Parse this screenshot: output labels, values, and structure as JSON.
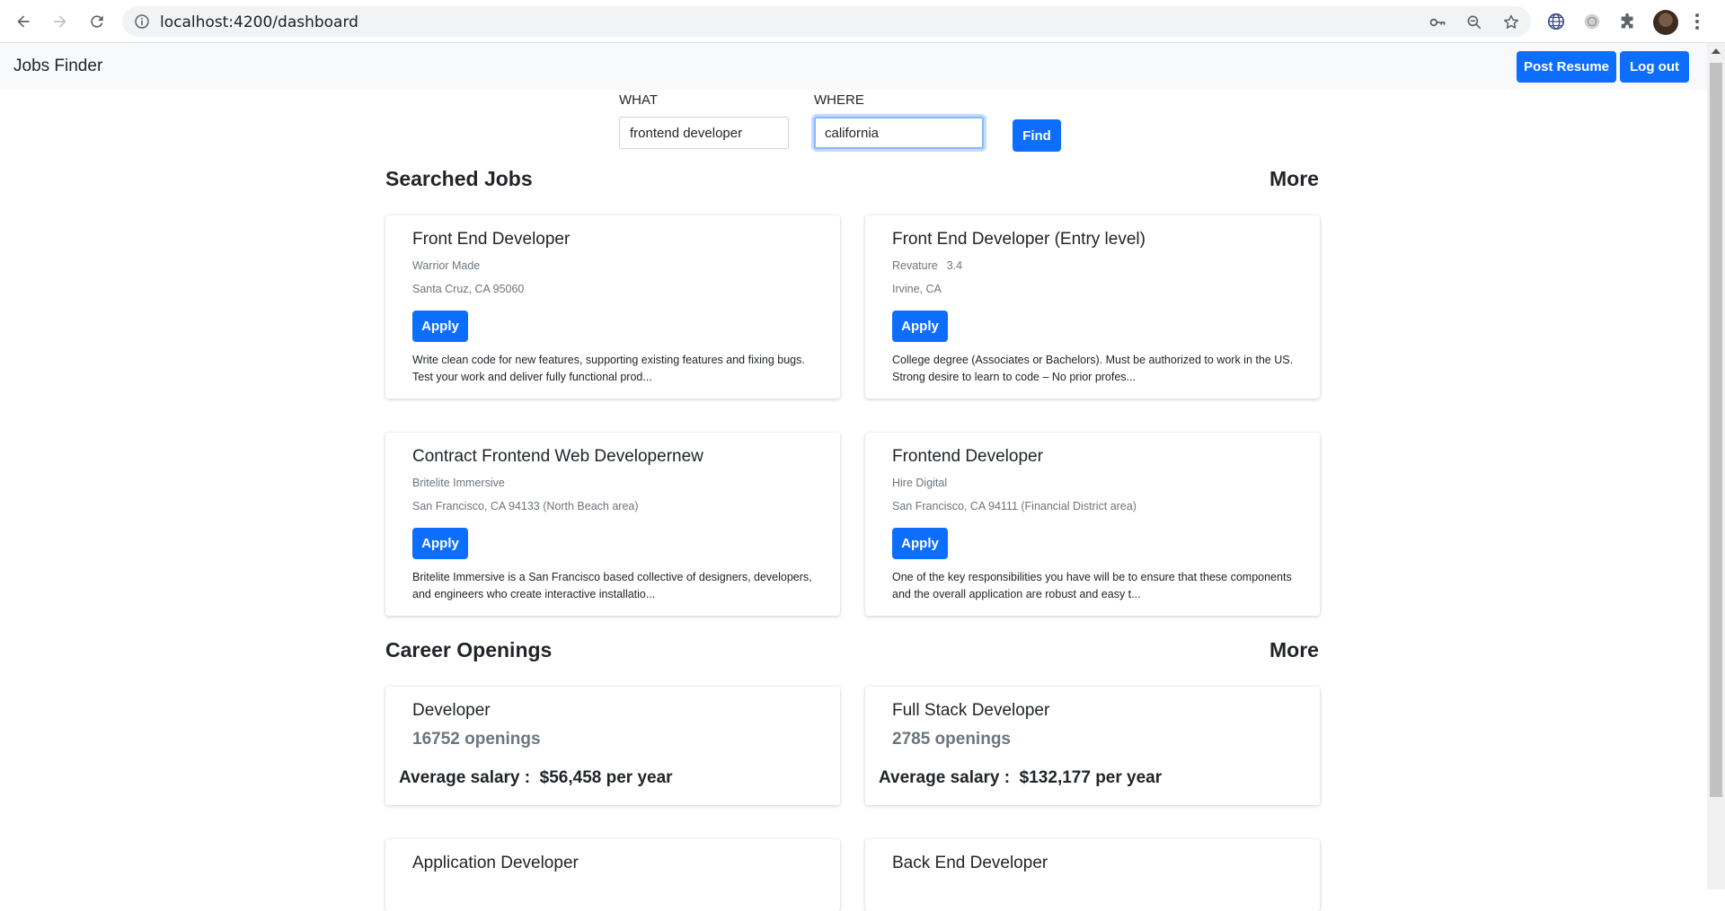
{
  "browser": {
    "url": "localhost:4200/dashboard"
  },
  "navbar": {
    "brand": "Jobs Finder",
    "post_resume_label": "Post Resume",
    "logout_label": "Log out"
  },
  "search": {
    "what_label": "WHAT",
    "what_value": "frontend developer",
    "where_label": "WHERE",
    "where_value": "california",
    "find_label": "Find"
  },
  "searched_jobs": {
    "title": "Searched Jobs",
    "more_label": "More",
    "apply_label": "Apply",
    "jobs": [
      {
        "title": "Front End Developer",
        "company": "Warrior Made",
        "rating": "",
        "location": "Santa Cruz, CA 95060",
        "description": "Write clean code for new features, supporting existing features and fixing bugs. Test your work and deliver fully functional prod..."
      },
      {
        "title": "Front End Developer (Entry level)",
        "company": "Revature",
        "rating": "3.4",
        "location": "Irvine, CA",
        "description": "College degree (Associates or Bachelors). Must be authorized to work in the US. Strong desire to learn to code – No prior profes..."
      },
      {
        "title": "Contract Frontend Web Developernew",
        "company": "Britelite Immersive",
        "rating": "",
        "location": "San Francisco, CA 94133 (North Beach area)",
        "description": "Britelite Immersive is a San Francisco based collective of designers, developers, and engineers who create interactive installatio..."
      },
      {
        "title": "Frontend Developer",
        "company": "Hire Digital",
        "rating": "",
        "location": "San Francisco, CA 94111 (Financial District area)",
        "description": "One of the key responsibilities you have will be to ensure that these components and the overall application are robust and easy t..."
      }
    ]
  },
  "career_openings": {
    "title": "Career Openings",
    "more_label": "More",
    "salary_prefix": "Average salary :  ",
    "items": [
      {
        "title": "Developer",
        "openings": "16752 openings",
        "salary": "$56,458 per year"
      },
      {
        "title": "Full Stack Developer",
        "openings": "2785 openings",
        "salary": "$132,177 per year"
      },
      {
        "title": "Application Developer",
        "openings": "",
        "salary": ""
      },
      {
        "title": "Back End Developer",
        "openings": "",
        "salary": ""
      }
    ]
  },
  "colors": {
    "primary": "#0d6efd",
    "navbar_bg": "#f8f9fa",
    "muted_text": "#6c757d"
  },
  "icons": [
    "back-arrow-icon",
    "forward-arrow-icon",
    "reload-icon",
    "info-icon",
    "key-icon",
    "zoom-icon",
    "star-icon",
    "globe-extension-icon",
    "extension-circle-icon",
    "puzzle-icon",
    "more-vert-icon"
  ]
}
